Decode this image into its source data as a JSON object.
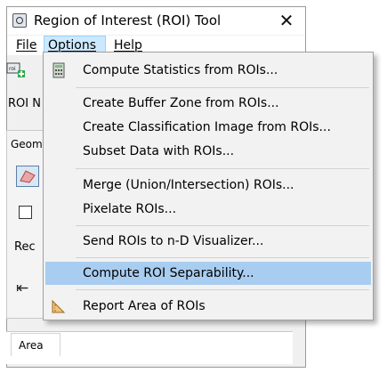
{
  "window": {
    "title": "Region of Interest (ROI) Tool",
    "close_glyph": "✕"
  },
  "menubar": {
    "file": "File",
    "options": "Options",
    "help": "Help"
  },
  "panel": {
    "roi_label": "ROI N",
    "geometry_tab": "Geom",
    "rec_label": "Rec",
    "first_glyph": "⇤",
    "area_tab": "Area"
  },
  "options_menu": {
    "items": [
      {
        "label": "Compute Statistics from ROIs...",
        "icon": "calculator-icon"
      },
      {
        "label": "Create Buffer Zone from ROIs..."
      },
      {
        "label": "Create Classification Image from ROIs..."
      },
      {
        "label": "Subset Data with ROIs..."
      },
      {
        "label": "Merge (Union/Intersection) ROIs..."
      },
      {
        "label": "Pixelate ROIs..."
      },
      {
        "label": "Send ROIs to n-D Visualizer..."
      },
      {
        "label": "Compute ROI Separability...",
        "highlighted": true
      },
      {
        "label": "Report Area of ROIs",
        "icon": "ruler-icon"
      }
    ]
  },
  "colors": {
    "highlight": "#a8cdf0",
    "menu_open": "#cce8ff"
  }
}
